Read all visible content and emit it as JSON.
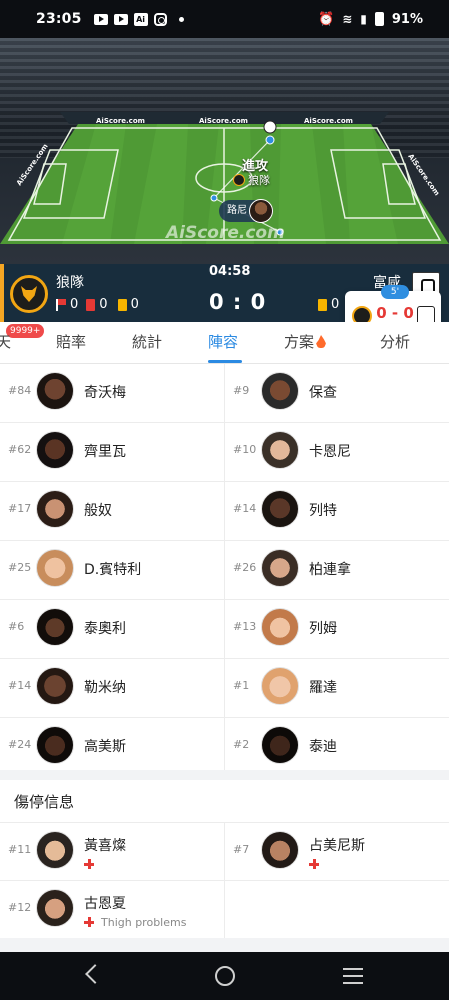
{
  "status_bar": {
    "time": "23:05",
    "battery": "91%"
  },
  "pitch": {
    "event": "進攻",
    "event_team": "狼隊",
    "player": "路尼",
    "ad_boards": [
      "AiScore.com",
      "AiScore.com",
      "AiScore.com",
      "AiScore.com",
      "AiScore.com"
    ],
    "watermark": "AiScore.com"
  },
  "match": {
    "home_name": "狼隊",
    "away_name": "富咸",
    "clock": "04:58",
    "score": "0 : 0",
    "home_corners": "0",
    "home_red": "0",
    "home_yellow": "0",
    "away_yellow": "0"
  },
  "mini_score": {
    "minute": "5'",
    "score": "0 - 0"
  },
  "tabs": [
    {
      "label": "天"
    },
    {
      "label": "賠率"
    },
    {
      "label": "統計"
    },
    {
      "label": "陣容"
    },
    {
      "label": "方案"
    },
    {
      "label": "分析"
    }
  ],
  "chat_badge": "9999+",
  "active_tab": "陣容",
  "lineup": [
    {
      "home": {
        "num": "#84",
        "name": "奇沃梅"
      },
      "away": {
        "num": "#9",
        "name": "保查"
      }
    },
    {
      "home": {
        "num": "#62",
        "name": "齊里瓦"
      },
      "away": {
        "num": "#10",
        "name": "卡恩尼"
      }
    },
    {
      "home": {
        "num": "#17",
        "name": "般奴"
      },
      "away": {
        "num": "#14",
        "name": "列特"
      }
    },
    {
      "home": {
        "num": "#25",
        "name": "D.賓特利"
      },
      "away": {
        "num": "#26",
        "name": "柏連拿"
      }
    },
    {
      "home": {
        "num": "#6",
        "name": "泰奧利"
      },
      "away": {
        "num": "#13",
        "name": "列姆"
      }
    },
    {
      "home": {
        "num": "#14",
        "name": "勒米纳"
      },
      "away": {
        "num": "#1",
        "name": "羅達"
      }
    },
    {
      "home": {
        "num": "#24",
        "name": "高美斯"
      },
      "away": {
        "num": "#2",
        "name": "泰迪"
      }
    }
  ],
  "injuries": {
    "title": "傷停信息",
    "rows": [
      {
        "left": {
          "num": "#11",
          "name": "黃喜燦",
          "reason": ""
        },
        "right": {
          "num": "#7",
          "name": "占美尼斯",
          "reason": ""
        }
      },
      {
        "left": {
          "num": "#12",
          "name": "古恩夏",
          "reason": "Thigh problems"
        }
      }
    ]
  },
  "colors": {
    "accent": "#2b8ae2",
    "score_bar_bg": "#182d3d",
    "home_gold": "#f2a613",
    "red_card": "#e53935",
    "yellow_card": "#f7b500"
  }
}
